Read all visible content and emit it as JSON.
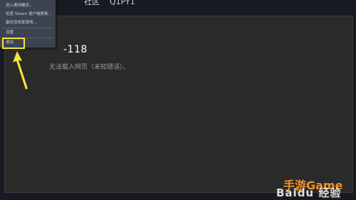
{
  "top_nav": {
    "items": [
      "社区",
      "Q1PY1"
    ]
  },
  "dropdown_menu": {
    "items": [
      {
        "label": "进入离线模式..."
      },
      {
        "label": "检查 Steam 客户端更新..."
      },
      {
        "label": "备份及恢复游戏..."
      },
      {
        "label": "设置"
      },
      {
        "label": "退出"
      }
    ]
  },
  "error_panel": {
    "code": "-118",
    "message": "无法载入网页（未知错误）。"
  },
  "watermarks": {
    "game": "手游Game",
    "baidu": "Baidu 经验"
  },
  "colors": {
    "highlight": "#f6e33b",
    "menu_bg": "#3d4450",
    "panel_bg": "#2a2a28",
    "watermark_game": "#f08f28"
  }
}
